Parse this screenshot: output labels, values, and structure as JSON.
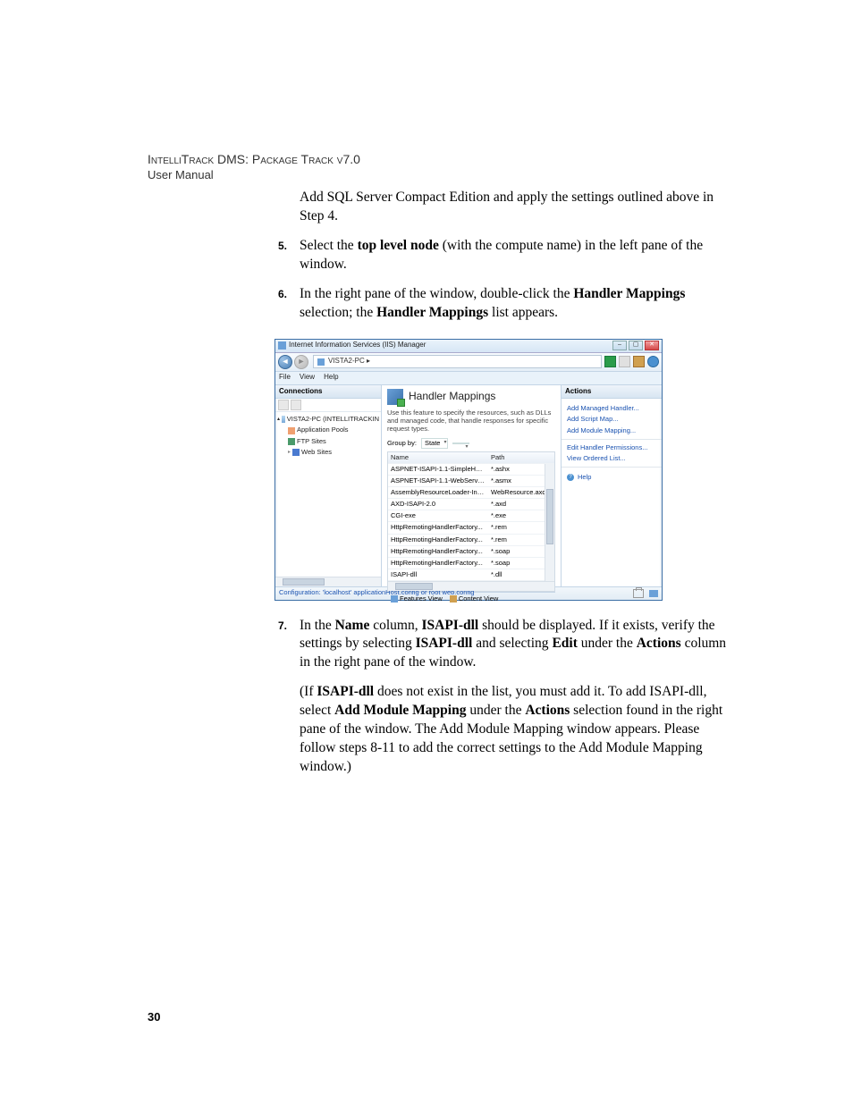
{
  "header": {
    "line1": "IntelliTrack DMS: Package Track v7.0",
    "line2": "User Manual"
  },
  "para_intro": "Add SQL Server Compact Edition and apply the settings outlined above in Step 4.",
  "step5": {
    "num": "5.",
    "t1": "Select the ",
    "b1": "top level node",
    "t2": " (with the compute name) in the left pane of the window."
  },
  "step6": {
    "num": "6.",
    "t1": "In the right pane of the window, double-click the ",
    "b1": "Handler Mappings",
    "t2": " selection; the ",
    "b2": "Handler Mappings",
    "t3": " list appears."
  },
  "step7": {
    "num": "7.",
    "t1": "In the ",
    "b1": "Name",
    "t2": " column, ",
    "b2": "ISAPI-dll",
    "t3": " should be displayed. If it exists, verify the settings by selecting ",
    "b3": "ISAPI-dll",
    "t4": " and selecting ",
    "b4": "Edit",
    "t5": " under the ",
    "b5": "Actions",
    "t6": " column in the right pane of the window."
  },
  "after7": {
    "t1": "(If ",
    "b1": "ISAPI-dll",
    "t2": " does not exist in the list, you must add it. To add ISAPI-dll, select ",
    "b2": "Add Module Mapping",
    "t3": " under the ",
    "b3": "Actions",
    "t4": " selection found in the right pane of the window. The Add Module Mapping window appears. Please follow steps 8-11 to add the correct settings to the Add Module Mapping window.)"
  },
  "iis": {
    "title": "Internet Information Services (IIS) Manager",
    "breadcrumb": "VISTA2-PC  ▸",
    "menu": {
      "file": "File",
      "view": "View",
      "help": "Help"
    },
    "connections": {
      "header": "Connections",
      "server": "VISTA2-PC (INTELLITRACKIN",
      "pool": "Application Pools",
      "ftp": "FTP Sites",
      "web": "Web Sites"
    },
    "mid": {
      "title": "Handler Mappings",
      "desc": "Use this feature to specify the resources, such as DLLs and managed code, that handle responses for specific request types.",
      "groupby_label": "Group by:",
      "groupby_value": "State",
      "col_name": "Name",
      "col_path": "Path",
      "rows": [
        {
          "name": "ASPNET-ISAPI-1.1-SimpleHan...",
          "path": "*.ashx"
        },
        {
          "name": "ASPNET-ISAPI-1.1-WebService...",
          "path": "*.asmx"
        },
        {
          "name": "AssemblyResourceLoader-Inte...",
          "path": "WebResource.axd"
        },
        {
          "name": "AXD-ISAPI-2.0",
          "path": "*.axd"
        },
        {
          "name": "CGI-exe",
          "path": "*.exe"
        },
        {
          "name": "HttpRemotingHandlerFactory...",
          "path": "*.rem"
        },
        {
          "name": "HttpRemotingHandlerFactory...",
          "path": "*.rem"
        },
        {
          "name": "HttpRemotingHandlerFactory...",
          "path": "*.soap"
        },
        {
          "name": "HttpRemotingHandlerFactory...",
          "path": "*.soap"
        },
        {
          "name": "ISAPI-dll",
          "path": "*.dll"
        }
      ],
      "tab_features": "Features View",
      "tab_content": "Content View"
    },
    "actions": {
      "header": "Actions",
      "a1": "Add Managed Handler...",
      "a2": "Add Script Map...",
      "a3": "Add Module Mapping...",
      "a4": "Edit Handler Permissions...",
      "a5": "View Ordered List...",
      "help": "Help"
    },
    "status": "Configuration: 'localhost' applicationHost.config or root web.config"
  },
  "pagenum": "30"
}
